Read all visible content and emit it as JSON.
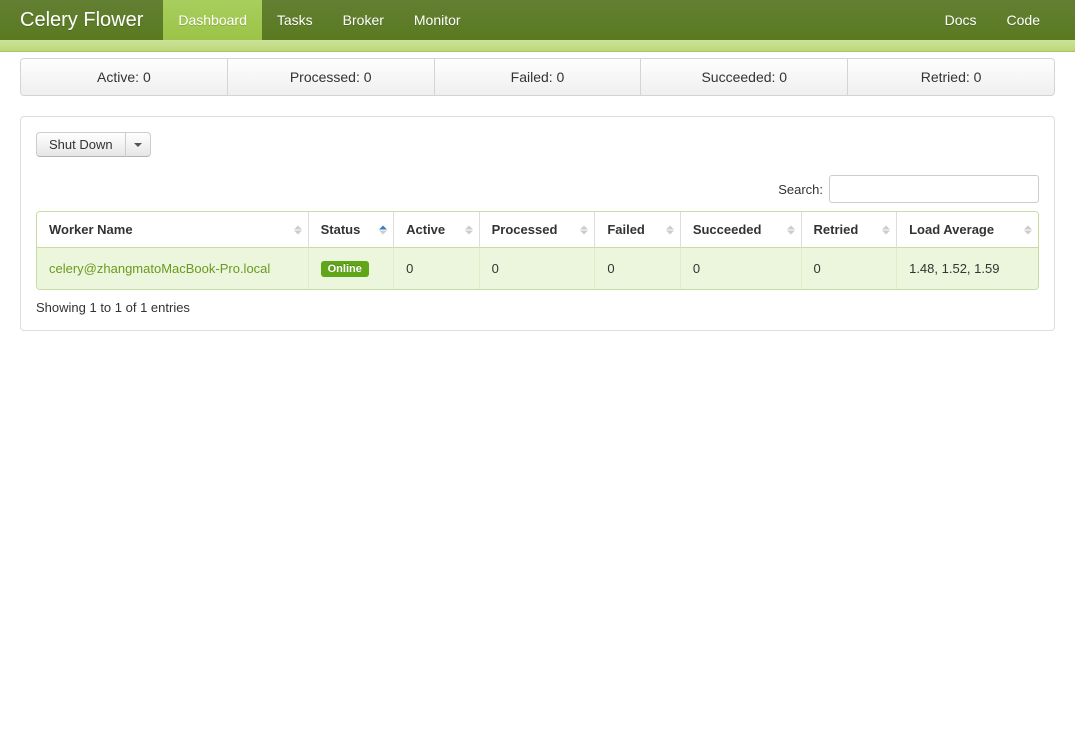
{
  "navbar": {
    "brand": "Celery Flower",
    "left": [
      {
        "label": "Dashboard",
        "active": true
      },
      {
        "label": "Tasks",
        "active": false
      },
      {
        "label": "Broker",
        "active": false
      },
      {
        "label": "Monitor",
        "active": false
      }
    ],
    "right": [
      {
        "label": "Docs"
      },
      {
        "label": "Code"
      }
    ]
  },
  "stats": {
    "active_label": "Active: 0",
    "processed_label": "Processed: 0",
    "failed_label": "Failed: 0",
    "succeeded_label": "Succeeded: 0",
    "retried_label": "Retried: 0"
  },
  "controls": {
    "shutdown_label": "Shut Down",
    "search_label": "Search:",
    "search_value": ""
  },
  "table": {
    "headers": {
      "worker_name": "Worker Name",
      "status": "Status",
      "active": "Active",
      "processed": "Processed",
      "failed": "Failed",
      "succeeded": "Succeeded",
      "retried": "Retried",
      "load_average": "Load Average"
    },
    "rows": [
      {
        "worker_name": "celery@zhangmatoMacBook-Pro.local",
        "status": "Online",
        "active": "0",
        "processed": "0",
        "failed": "0",
        "succeeded": "0",
        "retried": "0",
        "load_average": "1.48, 1.52, 1.59"
      }
    ],
    "info": "Showing 1 to 1 of 1 entries"
  }
}
